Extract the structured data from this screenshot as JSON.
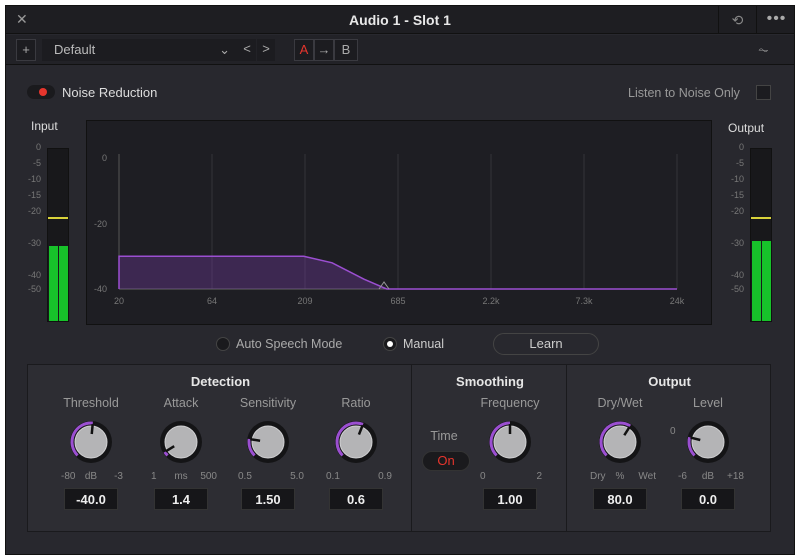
{
  "window": {
    "title": "Audio 1 - Slot 1",
    "close_icon": "close-icon",
    "reset_icon": "reset-icon",
    "more_icon": "more-icon"
  },
  "toolbar": {
    "add": "+",
    "preset": "Default",
    "prev": "<",
    "next": ">",
    "a": "A",
    "copy": "→",
    "b": "B",
    "graph_icon": "curve-icon"
  },
  "header": {
    "noise_reduction": "Noise Reduction",
    "noise_reduction_on": true,
    "listen_label": "Listen to Noise Only",
    "listen_checked": false
  },
  "meters": {
    "input": {
      "label": "Input",
      "scale": [
        "0",
        "-5",
        "-10",
        "-15",
        "-20",
        "-30",
        "-40",
        "-50"
      ],
      "level_db": -25,
      "peak_db": -15
    },
    "output": {
      "label": "Output",
      "scale": [
        "0",
        "-5",
        "-10",
        "-15",
        "-20",
        "-30",
        "-40",
        "-50"
      ],
      "level_db": -24,
      "peak_db": -15
    }
  },
  "graph": {
    "y_ticks": [
      "0",
      "-20",
      "-40"
    ],
    "x_ticks": [
      "20",
      "64",
      "209",
      "685",
      "2.2k",
      "7.3k",
      "24k"
    ],
    "curve": [
      [
        20,
        -30
      ],
      [
        209,
        -30
      ],
      [
        300,
        -32
      ],
      [
        450,
        -37
      ],
      [
        600,
        -40
      ],
      [
        24000,
        -40
      ]
    ],
    "curve_color": "#9b4fd1"
  },
  "mode": {
    "auto_speech": "Auto Speech Mode",
    "manual": "Manual",
    "selected": "manual",
    "learn": "Learn"
  },
  "detection": {
    "title": "Detection",
    "knobs": [
      {
        "label": "Threshold",
        "min": "-80",
        "unit": "dB",
        "max": "-3",
        "value": "-40.0",
        "fraction": 0.52
      },
      {
        "label": "Attack",
        "min": "1",
        "unit": "ms",
        "max": "500",
        "value": "1.4",
        "fraction": 0.05
      },
      {
        "label": "Sensitivity",
        "min": "0.5",
        "unit": "",
        "max": "5.0",
        "value": "1.50",
        "fraction": 0.2
      },
      {
        "label": "Ratio",
        "min": "0.1",
        "unit": "",
        "max": "0.9",
        "value": "0.6",
        "fraction": 0.58
      }
    ]
  },
  "smoothing": {
    "title": "Smoothing",
    "time_label": "Time",
    "time_value": "On",
    "knobs": [
      {
        "label": "Frequency",
        "min": "0",
        "unit": "",
        "max": "2",
        "value": "1.00",
        "fraction": 0.5
      }
    ]
  },
  "output": {
    "title": "Output",
    "knobs": [
      {
        "label": "Dry/Wet",
        "min": "Dry",
        "unit": "%",
        "max": "Wet",
        "value": "80.0",
        "fraction": 0.62
      },
      {
        "label": "Level",
        "min": "-6",
        "unit": "dB",
        "max": "+18",
        "value": "0.0",
        "fraction": 0.22,
        "zero_label": "0"
      }
    ]
  },
  "colors": {
    "accent": "#9b4fd1",
    "meter": "#17c22a",
    "peak": "#d8d23a",
    "active": "#e6352d"
  }
}
